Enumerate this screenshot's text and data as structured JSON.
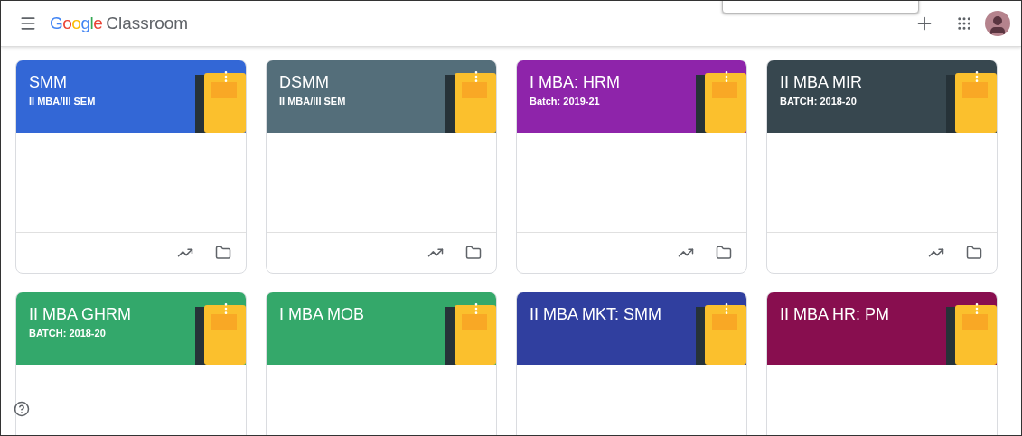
{
  "app": {
    "title_brand": "Google",
    "title_product": "Classroom"
  },
  "classes": [
    {
      "name": "SMM",
      "section": "II MBA/III SEM",
      "color": "#3367d6"
    },
    {
      "name": "DSMM",
      "section": "II MBA/III SEM",
      "color": "#546e7a"
    },
    {
      "name": "I MBA: HRM",
      "section": "Batch: 2019-21",
      "color": "#8e24aa"
    },
    {
      "name": "II MBA MIR",
      "section": "BATCH: 2018-20",
      "color": "#37474f"
    },
    {
      "name": "II MBA GHRM",
      "section": "BATCH: 2018-20",
      "color": "#33a86b"
    },
    {
      "name": "I MBA MOB",
      "color": "#34a86a"
    },
    {
      "name": "II MBA MKT: SMM",
      "color": "#303f9f"
    },
    {
      "name": "II MBA HR: PM",
      "color": "#880e4f"
    }
  ]
}
